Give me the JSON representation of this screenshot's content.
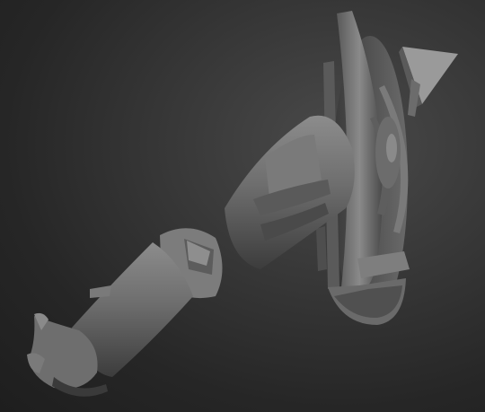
{
  "scene": {
    "subject": "sculpted-arm-with-shield-model",
    "colors": {
      "background_light": "#4a4a4a",
      "background_dark": "#1e1e1e",
      "clay_light": "#8a8a8a",
      "clay_mid": "#6a6a6a",
      "clay_dark": "#3a3a3a"
    }
  }
}
